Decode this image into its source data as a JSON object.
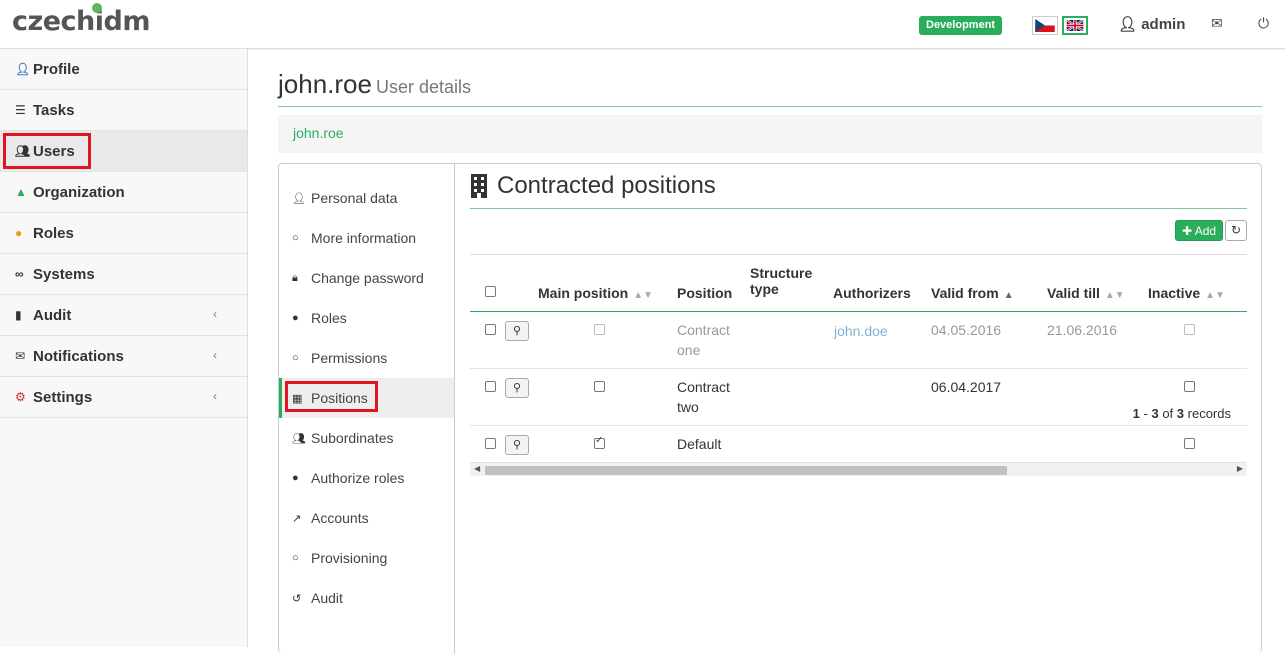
{
  "app": {
    "logo": "czechidm",
    "env_badge": "Development",
    "user": "admin",
    "colors": {
      "accent": "#2aae5c",
      "highlight": "#e0151f"
    }
  },
  "sidebar": {
    "items": [
      {
        "label": "Profile",
        "icon": "user-icon"
      },
      {
        "label": "Tasks",
        "icon": "tasks-icon"
      },
      {
        "label": "Users",
        "icon": "users-icon"
      },
      {
        "label": "Organization",
        "icon": "tree-icon"
      },
      {
        "label": "Roles",
        "icon": "roles-icon"
      },
      {
        "label": "Systems",
        "icon": "link-icon"
      },
      {
        "label": "Audit",
        "icon": "chart-icon"
      },
      {
        "label": "Notifications",
        "icon": "envelope-icon"
      },
      {
        "label": "Settings",
        "icon": "cog-icon"
      }
    ]
  },
  "page": {
    "title": "john.roe",
    "subtitle": "User details",
    "breadcrumb": "john.roe"
  },
  "subnav": {
    "items": [
      {
        "label": "Personal data"
      },
      {
        "label": "More information"
      },
      {
        "label": "Change password"
      },
      {
        "label": "Roles"
      },
      {
        "label": "Permissions"
      },
      {
        "label": "Positions"
      },
      {
        "label": "Subordinates"
      },
      {
        "label": "Authorize roles"
      },
      {
        "label": "Accounts"
      },
      {
        "label": "Provisioning"
      },
      {
        "label": "Audit"
      }
    ]
  },
  "section": {
    "title": "Contracted positions",
    "add_label": "Add"
  },
  "table": {
    "headers": {
      "main_position": "Main position",
      "position": "Position",
      "structure_type_1": "Structure",
      "structure_type_2": "type",
      "authorizers": "Authorizers",
      "valid_from": "Valid from",
      "valid_till": "Valid till",
      "inactive": "Inactive"
    },
    "rows": [
      {
        "position_1": "Contract",
        "position_2": "one",
        "authorizer": "john.doe",
        "valid_from": "04.05.2016",
        "valid_till": "21.06.2016",
        "main": false
      },
      {
        "position_1": "Contract",
        "position_2": "two",
        "authorizer": "",
        "valid_from": "06.04.2017",
        "valid_till": "",
        "main": false
      },
      {
        "position_1": "Default",
        "position_2": "",
        "authorizer": "",
        "valid_from": "",
        "valid_till": "",
        "main": true
      }
    ]
  },
  "pager": {
    "from": "1",
    "to": "3",
    "total": "3",
    "of": "of",
    "suffix": "records"
  }
}
